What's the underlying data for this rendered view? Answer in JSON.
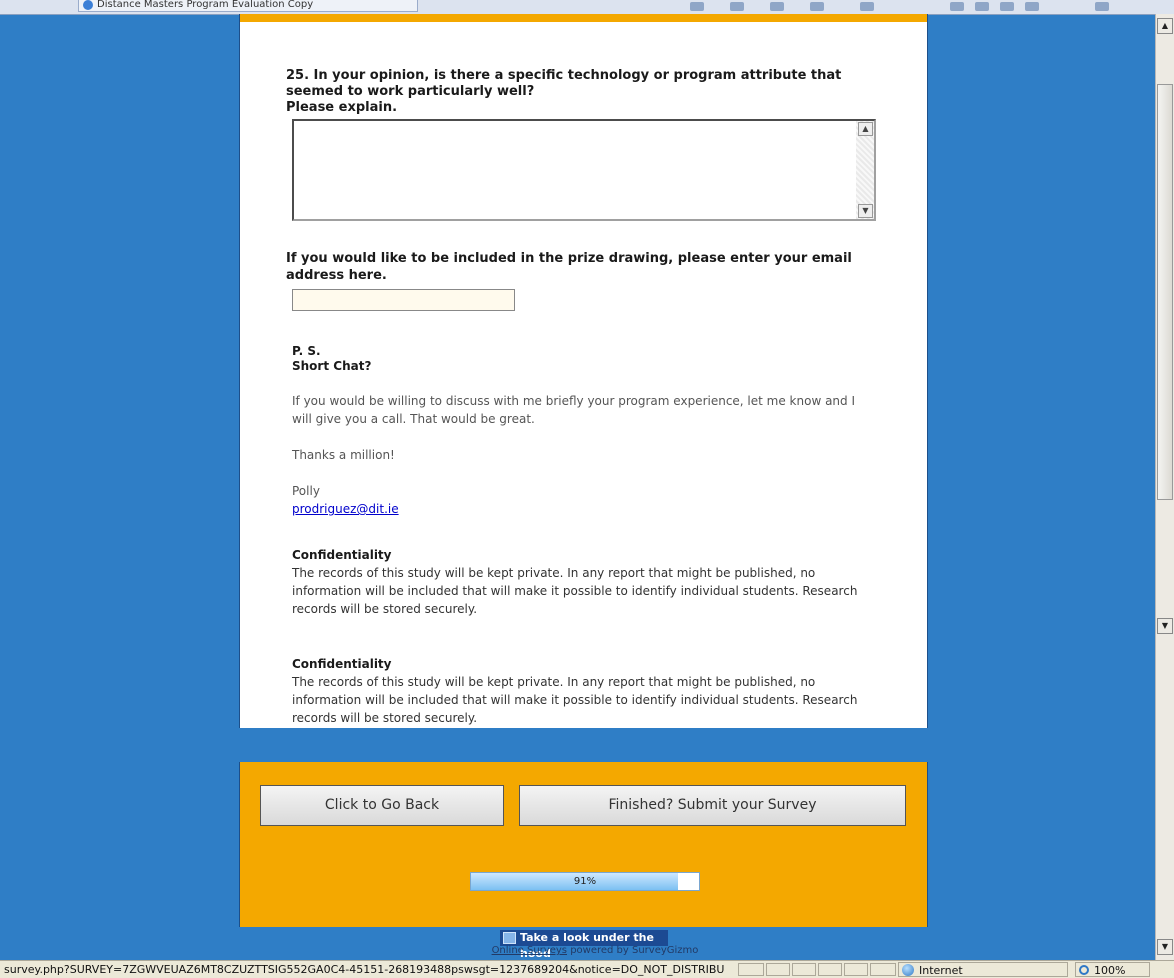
{
  "browser": {
    "tab_title": "Distance Masters Program Evaluation Copy",
    "status_url": "survey.php?SURVEY=7ZGWVEUAZ6MT8CZUZTTSIG552GA0C4-45151-268193488pswsgt=1237689204&notice=DO_NOT_DISTRIBU",
    "zone": "Internet",
    "zoom": "100%"
  },
  "survey": {
    "q25_text": "25. In your opinion, is there a specific technology or program attribute that seemed to work particularly well?",
    "q25_sub": "Please explain.",
    "q25_answer": "",
    "email_question": "If you would like to be included in the prize drawing, please enter your email address here.",
    "email_value": "",
    "ps_label": "P. S.",
    "short_chat": "Short Chat?",
    "chat_text": "If you would be willing to discuss with me briefly your program experience, let me know and I will give you a call. That would be great.",
    "thanks": "Thanks a million!",
    "signature": "Polly",
    "email_link": "prodriguez@dit.ie",
    "confidentiality": [
      {
        "title": "Confidentiality",
        "text": "The records of this study will be kept private. In any report that might be published, no information will be included that will make it possible to identify individual students. Research records will be stored securely."
      },
      {
        "title": "Confidentiality",
        "text": "The records of this study will be kept private. In any report that might be published, no information will be included that will make it possible to identify individual students. Research records will be stored securely."
      }
    ]
  },
  "nav": {
    "back_label": "Click to Go Back",
    "submit_label": "Finished? Submit your Survey",
    "progress_fraction": 0.91,
    "progress_label": "91%"
  },
  "footer": {
    "badge": "Take a look under the hood",
    "link_text": "Online Surveys",
    "powered": "powered by SurveyGizmo"
  }
}
